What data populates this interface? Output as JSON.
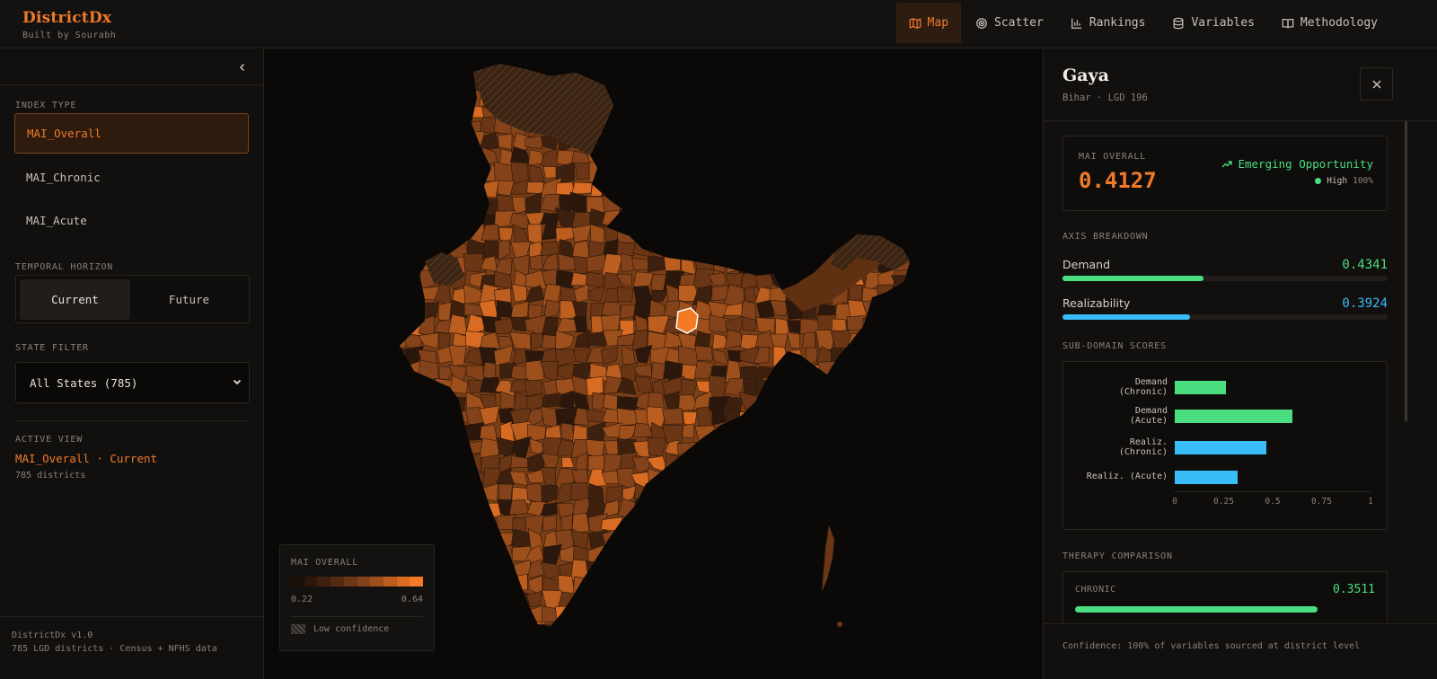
{
  "app": {
    "title": "DistrictDx",
    "subtitle": "Built by Sourabh"
  },
  "nav": [
    {
      "label": "Map",
      "icon": "map-icon",
      "active": true
    },
    {
      "label": "Scatter",
      "icon": "scatter-icon",
      "active": false
    },
    {
      "label": "Rankings",
      "icon": "bar-chart-icon",
      "active": false
    },
    {
      "label": "Variables",
      "icon": "database-icon",
      "active": false
    },
    {
      "label": "Methodology",
      "icon": "book-icon",
      "active": false
    }
  ],
  "sidebar": {
    "index_type_label": "INDEX TYPE",
    "index_options": [
      {
        "label": "MAI_Overall",
        "active": true
      },
      {
        "label": "MAI_Chronic",
        "active": false
      },
      {
        "label": "MAI_Acute",
        "active": false
      }
    ],
    "temporal_label": "TEMPORAL HORIZON",
    "temporal_options": [
      {
        "label": "Current",
        "active": true
      },
      {
        "label": "Future",
        "active": false
      }
    ],
    "state_filter_label": "STATE FILTER",
    "state_filter_value": "All States (785)",
    "active_view_label": "ACTIVE VIEW",
    "active_view_title": "MAI_Overall · Current",
    "active_view_count": "785 districts",
    "footer_version": "DistrictDx v1.0",
    "footer_info": "785 LGD districts · Census + NFHS data"
  },
  "legend": {
    "title": "MAI OVERALL",
    "min": "0.22",
    "max": "0.64",
    "low_confidence": "Low confidence",
    "colors": [
      "#1a0f08",
      "#2b170b",
      "#3e200e",
      "#532b12",
      "#6a3615",
      "#834219",
      "#9e501c",
      "#bb5e1f",
      "#d96c22",
      "#f47a26"
    ]
  },
  "panel": {
    "district": "Gaya",
    "meta": "Bihar · LGD 196",
    "score_label": "MAI OVERALL",
    "score_value": "0.4127",
    "opportunity": "Emerging Opportunity",
    "confidence_level": "High",
    "confidence_pct": "100%",
    "axis_label": "AXIS BREAKDOWN",
    "axes": [
      {
        "name": "Demand",
        "value": "0.4341",
        "fraction": 0.4341,
        "color": "#4ade80"
      },
      {
        "name": "Realizability",
        "value": "0.3924",
        "fraction": 0.3924,
        "color": "#38bdf8"
      }
    ],
    "subdomain_label": "SUB-DOMAIN SCORES",
    "therapy_label": "THERAPY COMPARISON",
    "therapy": {
      "name": "CHRONIC",
      "value": "0.3511",
      "fraction": 0.3511
    },
    "footer": "Confidence: 100% of variables sourced at district level"
  },
  "chart_data": {
    "type": "bar",
    "orientation": "horizontal",
    "categories": [
      "Demand\n(Chronic)",
      "Demand\n(Acute)",
      "Realiz.\n(Chronic)",
      "Realiz. (Acute)"
    ],
    "values": [
      0.26,
      0.6,
      0.47,
      0.32
    ],
    "colors": [
      "#4ade80",
      "#4ade80",
      "#38bdf8",
      "#38bdf8"
    ],
    "xlim": [
      0,
      1
    ],
    "xticks": [
      "0",
      "0.25",
      "0.5",
      "0.75",
      "1"
    ],
    "grid": false
  }
}
